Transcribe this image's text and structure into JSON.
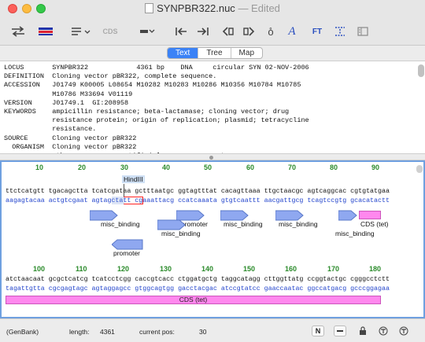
{
  "window": {
    "title": "SYNPBR322.nuc",
    "title_status": "— Edited"
  },
  "toolbar": {
    "cds_label": "CDS",
    "ft_label": "FT",
    "italic_a": "A",
    "circle_label": "o̊"
  },
  "view_tabs": [
    {
      "label": "Text",
      "active": true
    },
    {
      "label": "Tree",
      "active": false
    },
    {
      "label": "Map",
      "active": false
    }
  ],
  "genbank_text": [
    "LOCUS       SYNPBR322            4361 bp    DNA     circular SYN 02-NOV-2006",
    "DEFINITION  Cloning vector pBR322, complete sequence.",
    "ACCESSION   J01749 K00005 L08654 M10282 M10283 M10286 M10356 M10784 M10785",
    "            M10786 M33694 V01119",
    "VERSION     J01749.1  GI:208958",
    "KEYWORDS    ampicillin resistance; beta-lactamase; cloning vector; drug",
    "            resistance protein; origin of replication; plasmid; tetracycline",
    "            resistance.",
    "SOURCE      Cloning vector pBR322",
    "  ORGANISM  Cloning vector pBR322",
    "            other sequences; artificial sequences; vectors."
  ],
  "sequence": {
    "row1": {
      "ruler": [
        "10",
        "20",
        "30",
        "40",
        "50",
        "60",
        "70",
        "80",
        "90"
      ],
      "top": "ttctcatgtt tgacagctta tcatcgataa gctttaatgc ggtagtttat cacagttaaa ttgctaacgc agtcaggcac cgtgtatgaa",
      "bottom": "aagagtacaa actgtcgaat agtagctatt cgaaattacg ccatcaaata gtgtcaattt aacgattgcg tcagtccgtg gcacatactt",
      "enzyme": "HindIII",
      "features": [
        "misc_binding",
        "promoter",
        "misc_binding",
        "misc_binding",
        "misc_binding",
        "misc_binding",
        "CDS (tet)",
        "promoter"
      ]
    },
    "row2": {
      "ruler": [
        "100",
        "110",
        "120",
        "130",
        "140",
        "150",
        "160",
        "170",
        "180"
      ],
      "top": "atctaacaat gcgctcatcg tcatcctcgg caccgtcacc ctggatgctg taggcatagg cttggttatg ccggtactgc cgggcctctt",
      "bottom": "tagattgtta cgcgagtagc agtaggagcc gtggcagtgg gacctacgac atccgtatcc gaaccaatac ggccatgacg gcccggagaa",
      "feature": "CDS (tet)"
    }
  },
  "status": {
    "format": "(GenBank)",
    "length_label": "length:",
    "length_value": "4361",
    "pos_label": "current pos:",
    "pos_value": "30",
    "btn_n": "N"
  },
  "colors": {
    "cds": "#ff88ee",
    "arrow": "#8fa8f0",
    "ruler": "#2a8a2a",
    "complement": "#2244cc",
    "selection_tab": "#3b82f6"
  }
}
